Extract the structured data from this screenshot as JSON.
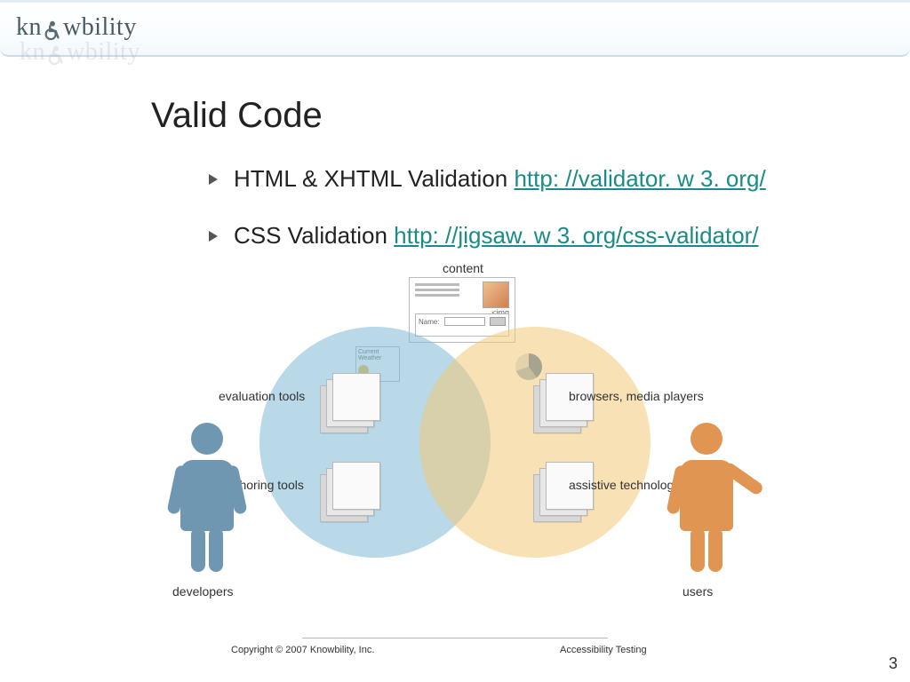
{
  "logo": {
    "brand": "knowbility"
  },
  "title": "Valid Code",
  "bullets": [
    {
      "text": "HTML & XHTML Validation ",
      "link_text": "http: //validator. w 3. org/"
    },
    {
      "text": "CSS Validation ",
      "link_text": "http: //jigsaw. w 3. org/css-validator/"
    }
  ],
  "diagram": {
    "top_label": "content",
    "content_box": {
      "field_label": "Name:",
      "tag_label": "<img"
    },
    "weather_label": "Current Weather",
    "labels": {
      "eval_tools": "evaluation tools",
      "authoring_tools": "authoring tools",
      "browsers": "browsers, media players",
      "assistive": "assistive technologies",
      "developers": "developers",
      "users": "users"
    }
  },
  "footer": {
    "copyright": "Copyright © 2007 Knowbility, Inc.",
    "right": "Accessibility Testing"
  },
  "page_number": "3"
}
